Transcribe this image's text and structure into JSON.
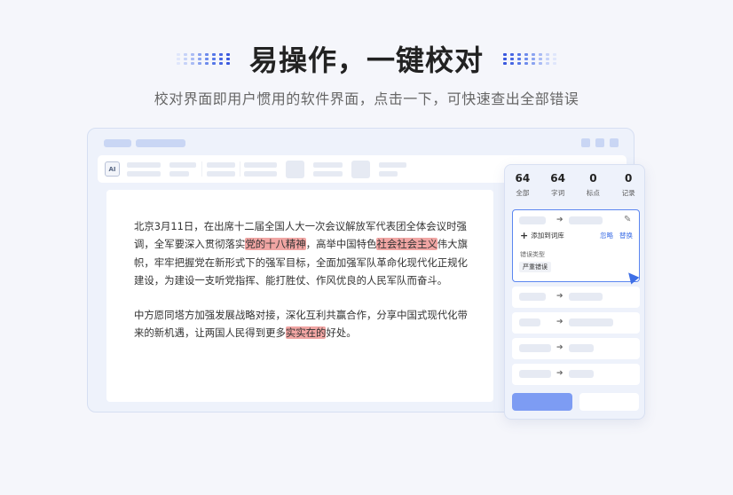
{
  "hero": {
    "title": "易操作，一键校对",
    "subtitle": "校对界面即用户惯用的软件界面，点击一下，可快速查出全部错误",
    "dot_colors": [
      "#dfe6fb",
      "#c6d2f8",
      "#a9bbf4",
      "#8aa3f0",
      "#6d8bec",
      "#5677e8",
      "#4766e3",
      "#3a58de"
    ]
  },
  "toolbar": {
    "doc_icon": "ai-doc-icon",
    "doc_icon_text": "AI"
  },
  "document": {
    "paragraphs": [
      [
        {
          "t": "北京3月11日，在出席十二届全国人大一次会议解放军代表团全体会议时强调，全军要深入贯彻落实"
        },
        {
          "t": "党的十八精神",
          "hl": true
        },
        {
          "t": "，高举中国特色"
        },
        {
          "t": "社会社会主义",
          "hl": true
        },
        {
          "t": "伟大旗帜，牢牢把握党在新形式下的强军目标，全面加强军队革命化现代化正规化建设，为建设一支听党指挥、能打胜仗、作风优良的人民军队而奋斗。"
        }
      ],
      [
        {
          "t": "中方愿同塔方加强发展战略对接，深化互利共赢合作，分享中国式现代化带来的新机遇，让两国人民得到更多"
        },
        {
          "t": "实实在的",
          "hl": true
        },
        {
          "t": "好处。"
        }
      ]
    ]
  },
  "panel": {
    "stats": [
      {
        "num": "64",
        "label": "全部"
      },
      {
        "num": "64",
        "label": "字词"
      },
      {
        "num": "0",
        "label": "标点"
      },
      {
        "num": "0",
        "label": "记录"
      }
    ],
    "active_card": {
      "add_label": "添加到词库",
      "ignore_label": "忽略",
      "replace_label": "替换",
      "error_type_label": "错误类型",
      "error_badge": "严重错误"
    },
    "arrow_glyph": "➔",
    "pencil_glyph": "✎",
    "plus_glyph": "+"
  },
  "colors": {
    "accent": "#3e6fe6",
    "highlight": "#f0a5a3",
    "primary_button": "#7d9cf3"
  }
}
